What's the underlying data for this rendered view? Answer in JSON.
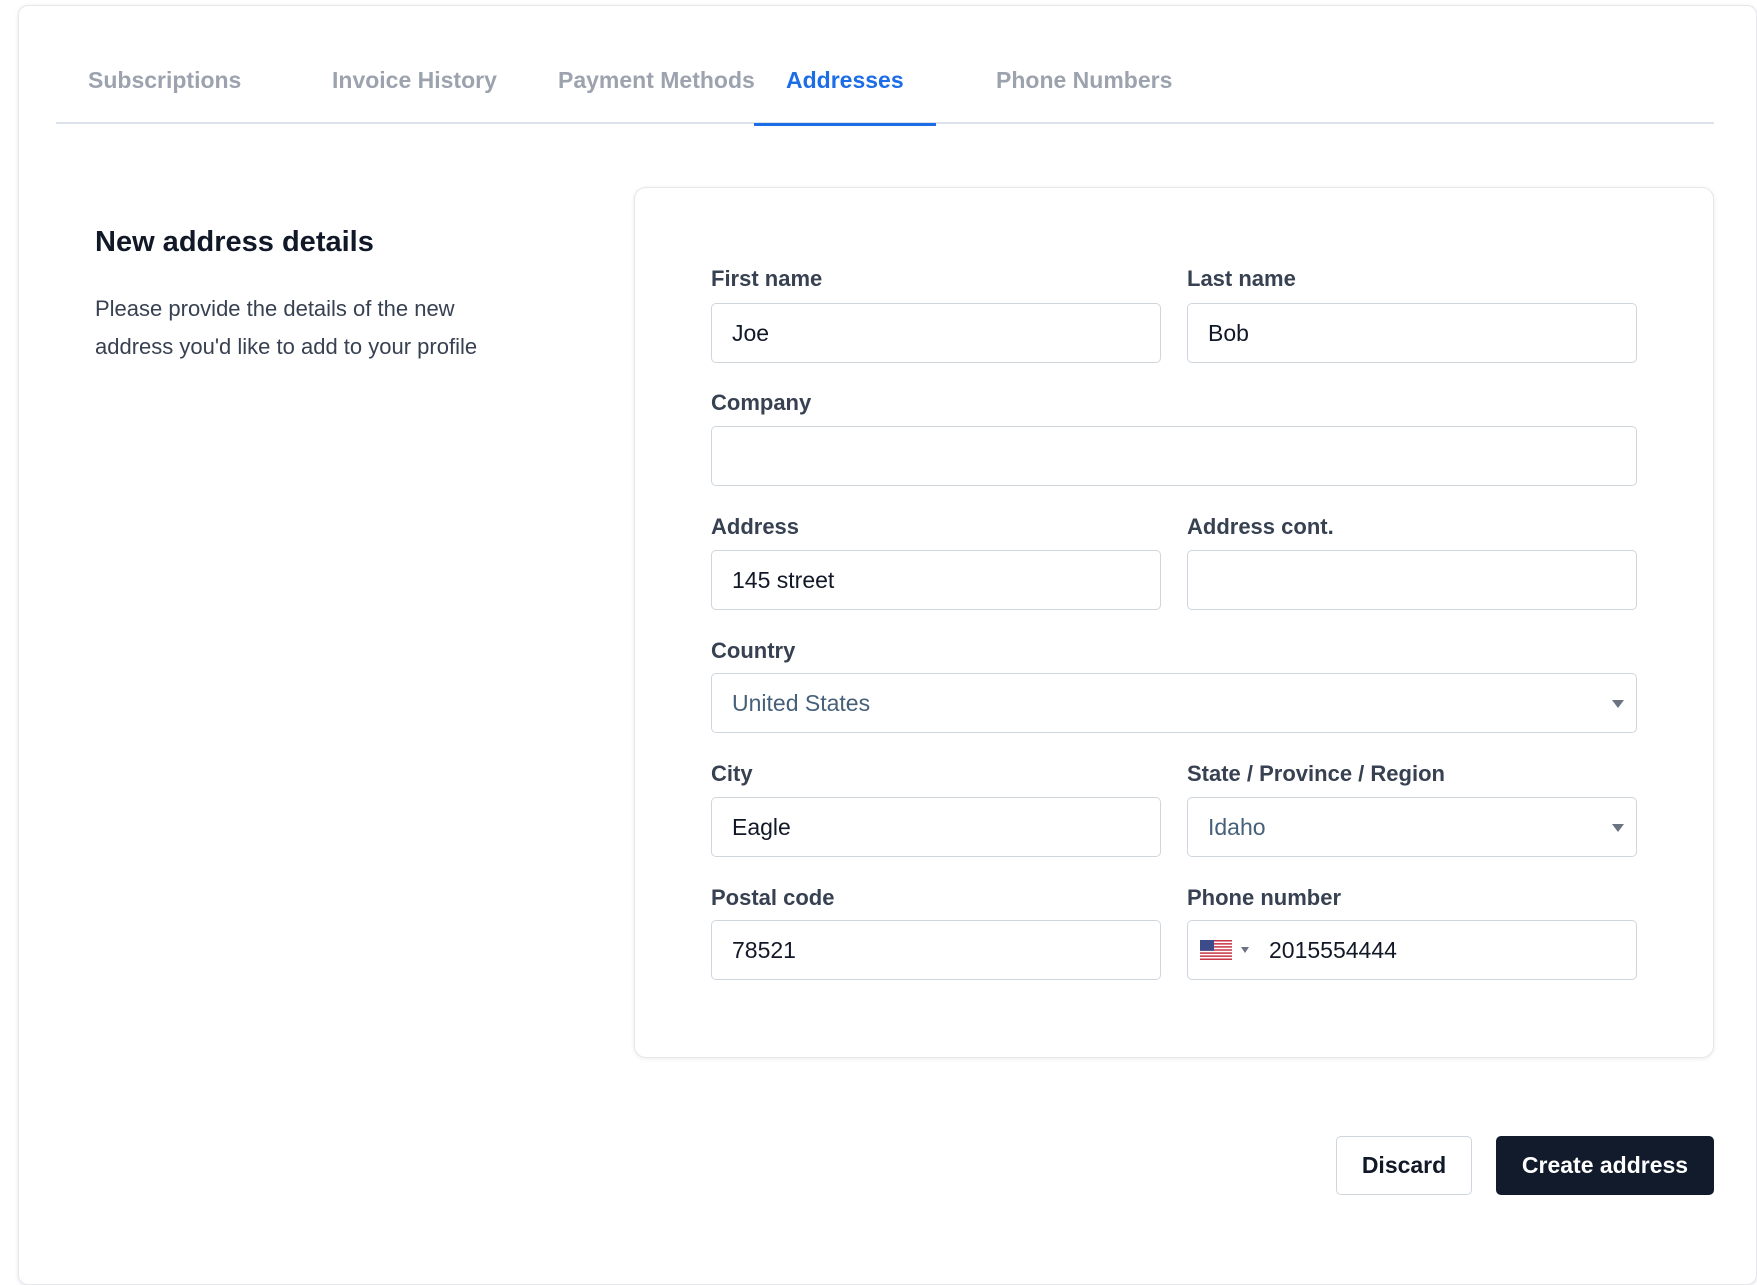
{
  "tabs": [
    {
      "label": "Subscriptions"
    },
    {
      "label": "Invoice History"
    },
    {
      "label": "Payment Methods"
    },
    {
      "label": "Addresses"
    },
    {
      "label": "Phone Numbers"
    }
  ],
  "active_tab": "Addresses",
  "section": {
    "title": "New address details",
    "description": "Please provide the details of the new address you'd like to add to your profile"
  },
  "form": {
    "first_name": {
      "label": "First name",
      "value": "Joe"
    },
    "last_name": {
      "label": "Last name",
      "value": "Bob"
    },
    "company": {
      "label": "Company",
      "value": ""
    },
    "address": {
      "label": "Address",
      "value": "145 street"
    },
    "address_cont": {
      "label": "Address cont.",
      "value": ""
    },
    "country": {
      "label": "Country",
      "value": "United States"
    },
    "city": {
      "label": "City",
      "value": "Eagle"
    },
    "state": {
      "label": "State / Province / Region",
      "value": "Idaho"
    },
    "postal_code": {
      "label": "Postal code",
      "value": "78521"
    },
    "phone": {
      "label": "Phone number",
      "value": "2015554444",
      "country_flag": "us-flag-icon"
    }
  },
  "actions": {
    "discard_label": "Discard",
    "create_label": "Create address"
  },
  "colors": {
    "accent": "#1d6ee6",
    "primary_button": "#111b2b",
    "tab_inactive": "#9ca3af"
  }
}
